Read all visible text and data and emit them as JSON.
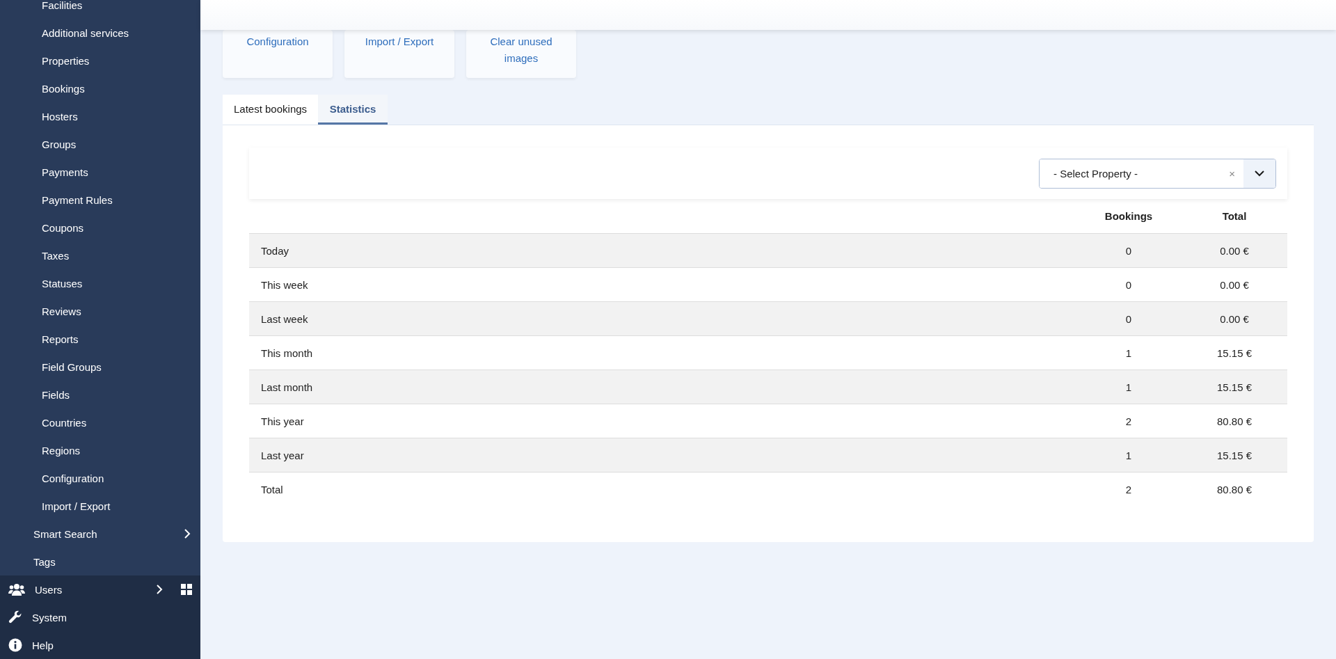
{
  "sidebar": {
    "items": [
      {
        "label": "Facilities",
        "kind": "sub",
        "expandable": false
      },
      {
        "label": "Additional services",
        "kind": "sub",
        "expandable": false
      },
      {
        "label": "Properties",
        "kind": "sub",
        "expandable": false
      },
      {
        "label": "Bookings",
        "kind": "sub",
        "expandable": false
      },
      {
        "label": "Hosters",
        "kind": "sub",
        "expandable": false
      },
      {
        "label": "Groups",
        "kind": "sub",
        "expandable": false
      },
      {
        "label": "Payments",
        "kind": "sub",
        "expandable": false
      },
      {
        "label": "Payment Rules",
        "kind": "sub",
        "expandable": false
      },
      {
        "label": "Coupons",
        "kind": "sub",
        "expandable": false
      },
      {
        "label": "Taxes",
        "kind": "sub",
        "expandable": false
      },
      {
        "label": "Statuses",
        "kind": "sub",
        "expandable": false
      },
      {
        "label": "Reviews",
        "kind": "sub",
        "expandable": false
      },
      {
        "label": "Reports",
        "kind": "sub",
        "expandable": false
      },
      {
        "label": "Field Groups",
        "kind": "sub",
        "expandable": false
      },
      {
        "label": "Fields",
        "kind": "sub",
        "expandable": false
      },
      {
        "label": "Countries",
        "kind": "sub",
        "expandable": false
      },
      {
        "label": "Regions",
        "kind": "sub",
        "expandable": false
      },
      {
        "label": "Configuration",
        "kind": "sub",
        "expandable": false
      },
      {
        "label": "Import / Export",
        "kind": "sub",
        "expandable": false
      },
      {
        "label": "Smart Search",
        "kind": "component",
        "expandable": true
      },
      {
        "label": "Tags",
        "kind": "component",
        "expandable": false
      }
    ],
    "main_items": [
      {
        "label": "Users",
        "kind": "users",
        "expandable": true,
        "dashboard_link": true
      },
      {
        "label": "System",
        "kind": "system",
        "expandable": false,
        "dashboard_link": false
      },
      {
        "label": "Help",
        "kind": "help",
        "expandable": false,
        "dashboard_link": false
      }
    ]
  },
  "quick_links": [
    "Configuration",
    "Import / Export",
    "Clear unused images"
  ],
  "tabs": [
    {
      "label": "Latest bookings",
      "selected": false
    },
    {
      "label": "Statistics",
      "selected": true
    }
  ],
  "filter": {
    "placeholder": "- Select Property -",
    "clear": "×"
  },
  "table": {
    "columns": [
      "Bookings",
      "Total"
    ],
    "rows": [
      {
        "period": "Today",
        "bookings": "0",
        "total": "0.00 €"
      },
      {
        "period": "This week",
        "bookings": "0",
        "total": "0.00 €"
      },
      {
        "period": "Last week",
        "bookings": "0",
        "total": "0.00 €"
      },
      {
        "period": "This month",
        "bookings": "1",
        "total": "15.15 €"
      },
      {
        "period": "Last month",
        "bookings": "1",
        "total": "15.15 €"
      },
      {
        "period": "This year",
        "bookings": "2",
        "total": "80.80 €"
      },
      {
        "period": "Last year",
        "bookings": "1",
        "total": "15.15 €"
      },
      {
        "period": "Total",
        "bookings": "2",
        "total": "80.80 €"
      }
    ]
  }
}
